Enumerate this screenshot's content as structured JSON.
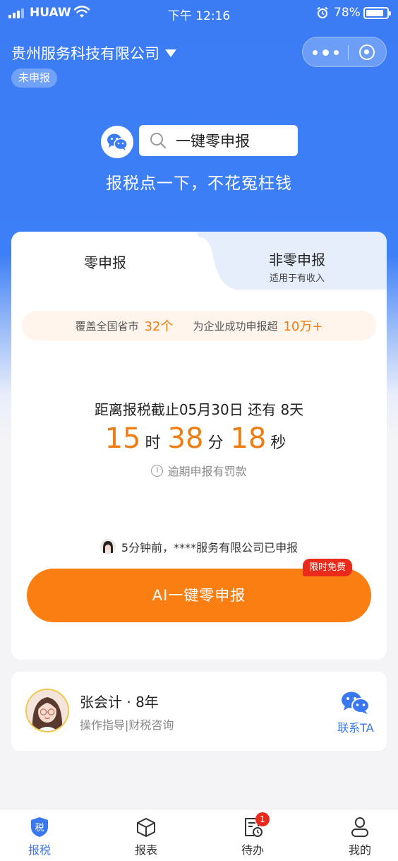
{
  "status_bar": {
    "carrier": "HUAW",
    "time": "下午 12:16",
    "battery_percent": "78%",
    "battery_level": 0.78
  },
  "header": {
    "company_name": "贵州服务科技有限公司",
    "status_tag": "未申报"
  },
  "hero": {
    "search_text": "一键零申报",
    "slogan": "报税点一下，不花冤枉钱"
  },
  "tabs": {
    "zero": {
      "label": "零申报"
    },
    "nonzero": {
      "label": "非零申报",
      "subtitle": "适用于有收入"
    }
  },
  "coverage": {
    "label1": "覆盖全国省市",
    "value1": "32个",
    "label2": "为企业成功申报超",
    "value2": "10万+"
  },
  "deadline": {
    "text": "距离报税截止05月30日 还有 8天",
    "hours": "15",
    "hours_unit": "时",
    "minutes": "38",
    "minutes_unit": "分",
    "seconds": "18",
    "seconds_unit": "秒",
    "penalty_note": "逾期申报有罚款"
  },
  "recent_activity": "5分钟前，****服务有限公司已申报",
  "cta": {
    "label": "AI一键零申报",
    "badge": "限时免费"
  },
  "accountant": {
    "name": "张会计 · 8年",
    "tags": "操作指导|财税咨询",
    "contact_label": "联系TA"
  },
  "tabbar": {
    "items": [
      {
        "label": "报税",
        "icon": "tax-shield-icon",
        "active": true
      },
      {
        "label": "报表",
        "icon": "box-icon"
      },
      {
        "label": "待办",
        "icon": "todo-clock-icon",
        "badge": "1"
      },
      {
        "label": "我的",
        "icon": "user-icon"
      }
    ]
  },
  "colors": {
    "brand_blue": "#3b7cf5",
    "accent_orange": "#fb7e13",
    "badge_red": "#ea2a1a"
  }
}
